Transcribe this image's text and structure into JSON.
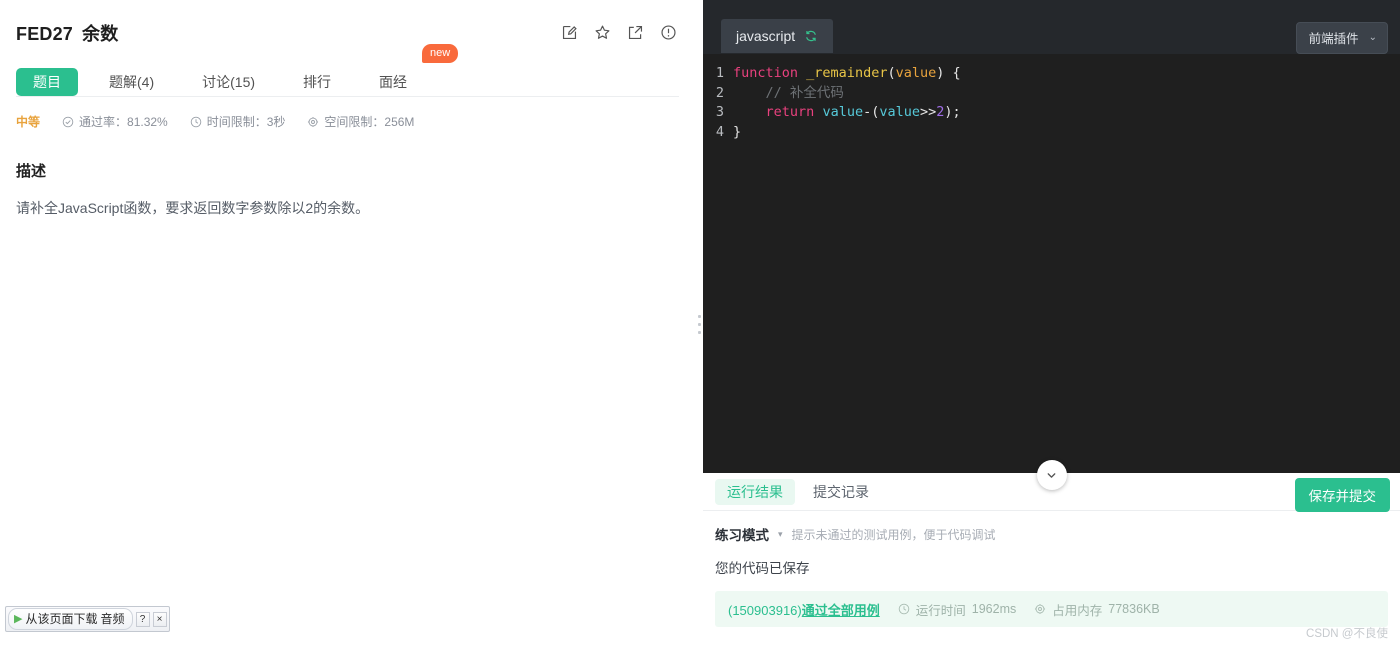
{
  "problem": {
    "code": "FED27",
    "title": "余数",
    "head_icons": [
      "note-edit-icon",
      "star-icon",
      "share-external-icon",
      "info-circle-icon"
    ],
    "tabs": [
      {
        "label": "题目",
        "active": true
      },
      {
        "label": "题解(4)",
        "active": false
      },
      {
        "label": "讨论(15)",
        "active": false
      },
      {
        "label": "排行",
        "active": false
      },
      {
        "label": "面经",
        "active": false
      }
    ],
    "new_badge": "new",
    "meta": {
      "difficulty": "中等",
      "pass_rate_label": "通过率：81.32%",
      "time_limit_label": "时间限制：3秒",
      "space_limit_label": "空间限制：256M"
    },
    "description_title": "描述",
    "description_body": "请补全JavaScript函数，要求返回数字参数除以2的余数。"
  },
  "download_bar": {
    "play_glyph": "▶",
    "text": "从该页面下载",
    "subtext": "音频",
    "help": "?",
    "close": "×"
  },
  "editor": {
    "language_tab": "javascript",
    "reset_icon": "refresh-icon",
    "plugin_button": "前端插件",
    "plugin_caret": "⌄",
    "lines": [
      {
        "n": "1",
        "tokens": [
          {
            "t": "function",
            "c": "t-kw"
          },
          {
            "t": " ",
            "c": "t-pun"
          },
          {
            "t": "_remainder",
            "c": "t-fn"
          },
          {
            "t": "(",
            "c": "t-pun"
          },
          {
            "t": "value",
            "c": "t-par"
          },
          {
            "t": ") {",
            "c": "t-pun"
          }
        ]
      },
      {
        "n": "2",
        "tokens": [
          {
            "t": "    // 补全代码",
            "c": "t-com"
          }
        ]
      },
      {
        "n": "3",
        "tokens": [
          {
            "t": "    ",
            "c": "t-pun"
          },
          {
            "t": "return",
            "c": "t-kw"
          },
          {
            "t": " ",
            "c": "t-pun"
          },
          {
            "t": "value",
            "c": "t-var"
          },
          {
            "t": "-(",
            "c": "t-pun"
          },
          {
            "t": "value",
            "c": "t-var"
          },
          {
            "t": ">>",
            "c": "t-pun"
          },
          {
            "t": "2",
            "c": "t-num"
          },
          {
            "t": ");",
            "c": "t-pun"
          }
        ]
      },
      {
        "n": "4",
        "tokens": [
          {
            "t": "}",
            "c": "t-pun"
          }
        ]
      }
    ],
    "collapse_icon": "chevron-down-icon"
  },
  "result": {
    "tabs": [
      {
        "label": "运行结果",
        "active": true
      },
      {
        "label": "提交记录",
        "active": false
      }
    ],
    "submit_button": "保存并提交",
    "mode_name": "练习模式",
    "mode_caret": "▾",
    "mode_hint": "提示未通过的测试用例，便于代码调试",
    "saved_message": "您的代码已保存",
    "pass_id": "(150903916)",
    "pass_text": "通过全部用例",
    "runtime_label": "运行时间",
    "runtime_value": "1962ms",
    "memory_label": "占用内存",
    "memory_value": "77836KB"
  },
  "watermark": "CSDN @不良使",
  "colors": {
    "accent_green": "#2bbf8f",
    "badge_orange": "#f96a3c",
    "difficulty_orange": "#e8a33d",
    "editor_bg": "#1f1f1f",
    "editor_chrome": "#25282c"
  }
}
